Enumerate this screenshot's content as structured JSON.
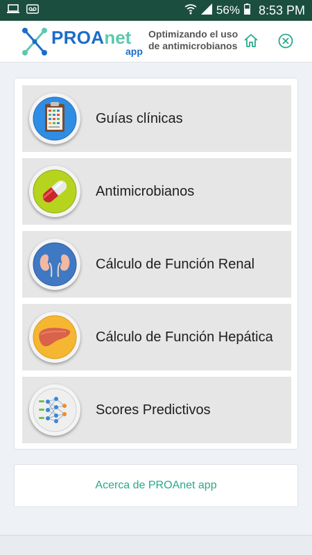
{
  "status_bar": {
    "battery_percent": "56%",
    "time": "8:53 PM",
    "icons": [
      "laptop-icon",
      "voicemail-icon",
      "wifi-icon",
      "signal-icon",
      "battery-icon"
    ]
  },
  "header": {
    "brand_main": "PROA",
    "brand_accent": "net",
    "brand_sub": "app",
    "tagline_line1": "Optimizando el uso",
    "tagline_line2": "de antimicrobianos",
    "home_icon": "home-icon",
    "close_icon": "close-circle-icon"
  },
  "menu": {
    "items": [
      {
        "label": "Guías clínicas",
        "icon": "clipboard-icon"
      },
      {
        "label": "Antimicrobianos",
        "icon": "capsule-icon"
      },
      {
        "label": "Cálculo de Función Renal",
        "icon": "kidneys-icon"
      },
      {
        "label": "Cálculo de Función Hepática",
        "icon": "liver-icon"
      },
      {
        "label": "Scores Predictivos",
        "icon": "network-icon"
      }
    ]
  },
  "about": {
    "link_label": "Acerca de PROAnet app"
  },
  "colors": {
    "status_bar": "#1b4e3e",
    "brand_blue": "#1b6dc8",
    "brand_teal": "#5cc8b0",
    "accent_green": "#27a988"
  }
}
